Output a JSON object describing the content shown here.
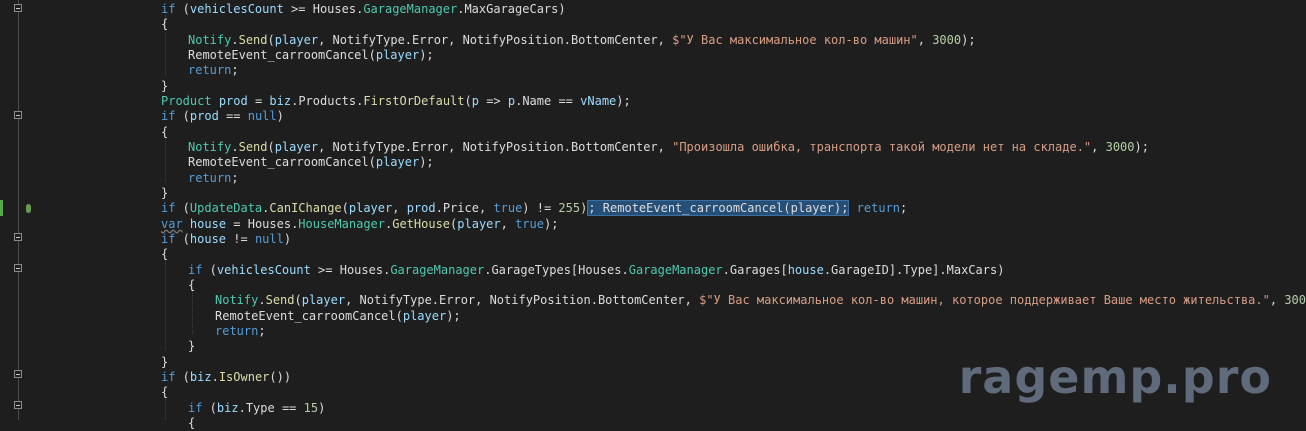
{
  "colors": {
    "background": "#1e1e1e",
    "keyword": "#569cd6",
    "variable": "#9cdcfe",
    "type": "#4ec9b0",
    "method": "#dcdcaa",
    "string": "#d69d85",
    "number": "#b5cea8",
    "plain": "#dcdcdc",
    "selection": "#264f78"
  },
  "watermark": "ragemp.pro",
  "lines": [
    [
      {
        "t": "if",
        "c": "kw"
      },
      {
        "t": " ("
      },
      {
        "t": "vehiclesCount",
        "c": "var"
      },
      {
        "t": " >= Houses."
      },
      {
        "t": "GarageManager",
        "c": "cls"
      },
      {
        "t": ".MaxGarageCars)"
      }
    ],
    [
      {
        "t": "{"
      }
    ],
    [
      {
        "t": "Notify",
        "c": "cls"
      },
      {
        "t": "."
      },
      {
        "t": "Send",
        "c": "method"
      },
      {
        "t": "("
      },
      {
        "t": "player",
        "c": "var"
      },
      {
        "t": ", NotifyType.Error, NotifyPosition.BottomCenter, "
      },
      {
        "t": "$\"У Вас максимальное кол-во машин\"",
        "c": "str"
      },
      {
        "t": ", "
      },
      {
        "t": "3000",
        "c": "num"
      },
      {
        "t": ");"
      }
    ],
    [
      {
        "t": "RemoteEvent_carroomCancel("
      },
      {
        "t": "player",
        "c": "var"
      },
      {
        "t": ");"
      }
    ],
    [
      {
        "t": "return",
        "c": "kw"
      },
      {
        "t": ";"
      }
    ],
    [
      {
        "t": "}"
      }
    ],
    [
      {
        "t": "Product",
        "c": "cls"
      },
      {
        "t": " "
      },
      {
        "t": "prod",
        "c": "var"
      },
      {
        "t": " = "
      },
      {
        "t": "biz",
        "c": "var"
      },
      {
        "t": ".Products."
      },
      {
        "t": "FirstOrDefault",
        "c": "method"
      },
      {
        "t": "("
      },
      {
        "t": "p",
        "c": "var"
      },
      {
        "t": " => "
      },
      {
        "t": "p",
        "c": "var"
      },
      {
        "t": ".Name == "
      },
      {
        "t": "vName",
        "c": "var"
      },
      {
        "t": ");"
      }
    ],
    [
      {
        "t": "if",
        "c": "kw"
      },
      {
        "t": " ("
      },
      {
        "t": "prod",
        "c": "var"
      },
      {
        "t": " == "
      },
      {
        "t": "null",
        "c": "kw"
      },
      {
        "t": ")"
      }
    ],
    [
      {
        "t": "{"
      }
    ],
    [
      {
        "t": "Notify",
        "c": "cls"
      },
      {
        "t": "."
      },
      {
        "t": "Send",
        "c": "method"
      },
      {
        "t": "("
      },
      {
        "t": "player",
        "c": "var"
      },
      {
        "t": ", NotifyType.Error, NotifyPosition.BottomCenter, "
      },
      {
        "t": "\"Произошла ошибка, транспорта такой модели нет на складе.\"",
        "c": "str"
      },
      {
        "t": ", "
      },
      {
        "t": "3000",
        "c": "num"
      },
      {
        "t": ");"
      }
    ],
    [
      {
        "t": "RemoteEvent_carroomCancel("
      },
      {
        "t": "player",
        "c": "var"
      },
      {
        "t": ");"
      }
    ],
    [
      {
        "t": "return",
        "c": "kw"
      },
      {
        "t": ";"
      }
    ],
    [
      {
        "t": "}"
      }
    ],
    [
      {
        "t": "if",
        "c": "kw"
      },
      {
        "t": " ("
      },
      {
        "t": "UpdateData",
        "c": "cls"
      },
      {
        "t": "."
      },
      {
        "t": "CanIChange",
        "c": "method"
      },
      {
        "t": "("
      },
      {
        "t": "player",
        "c": "var"
      },
      {
        "t": ", "
      },
      {
        "t": "prod",
        "c": "var"
      },
      {
        "t": ".Price, "
      },
      {
        "t": "true",
        "c": "kw"
      },
      {
        "t": ") != "
      },
      {
        "t": "255",
        "c": "num"
      },
      {
        "t": ")"
      },
      {
        "t": "; RemoteEvent_carroomCancel(player);",
        "c": "sel"
      },
      {
        "t": " "
      },
      {
        "t": "return",
        "c": "kw"
      },
      {
        "t": ";"
      }
    ],
    [
      {
        "t": "var",
        "c": "kw squiggle"
      },
      {
        "t": " "
      },
      {
        "t": "house",
        "c": "var"
      },
      {
        "t": " = Houses."
      },
      {
        "t": "HouseManager",
        "c": "cls"
      },
      {
        "t": "."
      },
      {
        "t": "GetHouse",
        "c": "method"
      },
      {
        "t": "("
      },
      {
        "t": "player",
        "c": "var"
      },
      {
        "t": ", "
      },
      {
        "t": "true",
        "c": "kw"
      },
      {
        "t": ");"
      }
    ],
    [
      {
        "t": "if",
        "c": "kw"
      },
      {
        "t": " ("
      },
      {
        "t": "house",
        "c": "var"
      },
      {
        "t": " != "
      },
      {
        "t": "null",
        "c": "kw"
      },
      {
        "t": ")"
      }
    ],
    [
      {
        "t": "{"
      }
    ],
    [
      {
        "t": "if",
        "c": "kw"
      },
      {
        "t": " ("
      },
      {
        "t": "vehiclesCount",
        "c": "var"
      },
      {
        "t": " >= Houses."
      },
      {
        "t": "GarageManager",
        "c": "cls"
      },
      {
        "t": ".GarageTypes[Houses."
      },
      {
        "t": "GarageManager",
        "c": "cls"
      },
      {
        "t": ".Garages["
      },
      {
        "t": "house",
        "c": "var"
      },
      {
        "t": ".GarageID].Type].MaxCars)"
      }
    ],
    [
      {
        "t": "{"
      }
    ],
    [
      {
        "t": "Notify",
        "c": "cls"
      },
      {
        "t": "."
      },
      {
        "t": "Send",
        "c": "method"
      },
      {
        "t": "("
      },
      {
        "t": "player",
        "c": "var"
      },
      {
        "t": ", NotifyType.Error, NotifyPosition.BottomCenter, "
      },
      {
        "t": "$\"У Вас максимальное кол-во машин, которое поддерживает Ваше место жительства.\"",
        "c": "str"
      },
      {
        "t": ", "
      },
      {
        "t": "3000",
        "c": "num"
      },
      {
        "t": ");"
      }
    ],
    [
      {
        "t": "RemoteEvent_carroomCancel("
      },
      {
        "t": "player",
        "c": "var"
      },
      {
        "t": ");"
      }
    ],
    [
      {
        "t": "return",
        "c": "kw"
      },
      {
        "t": ";"
      }
    ],
    [
      {
        "t": "}"
      }
    ],
    [
      {
        "t": "}"
      }
    ],
    [
      {
        "t": "if",
        "c": "kw"
      },
      {
        "t": " ("
      },
      {
        "t": "biz",
        "c": "var"
      },
      {
        "t": "."
      },
      {
        "t": "IsOwner",
        "c": "method"
      },
      {
        "t": "())"
      }
    ],
    [
      {
        "t": "{"
      }
    ],
    [
      {
        "t": "if",
        "c": "kw"
      },
      {
        "t": " ("
      },
      {
        "t": "biz",
        "c": "var"
      },
      {
        "t": ".Type == "
      },
      {
        "t": "15",
        "c": "num"
      },
      {
        "t": ")"
      }
    ],
    [
      {
        "t": "{"
      }
    ]
  ]
}
